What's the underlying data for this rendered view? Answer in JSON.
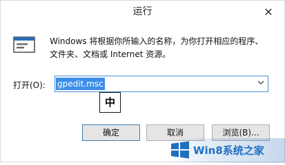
{
  "window": {
    "title": "运行",
    "close_glyph": "✕"
  },
  "dialog": {
    "description": "Windows 将根据你所输入的名称，为你打开相应的程序、文件夹、文档或 Internet 资源。",
    "open_label": "打开(O):",
    "combo_value": "gpedit.msc",
    "combo_arrow": "⌄",
    "ime_indicator": "中"
  },
  "buttons": {
    "ok": "确定",
    "cancel": "取消",
    "browse": "浏览(B)..."
  },
  "watermark": {
    "text": "Win8系统之家"
  },
  "colors": {
    "selection": "#3d8ee8",
    "input_border": "#4a90d9",
    "button_bg": "#e5e5e5",
    "watermark_text": "#1f6fbf"
  },
  "icons": {
    "run_icon": "run-dialog-icon",
    "close_icon": "close-icon",
    "dropdown_icon": "chevron-down-icon",
    "windows_logo": "windows-logo-icon"
  }
}
